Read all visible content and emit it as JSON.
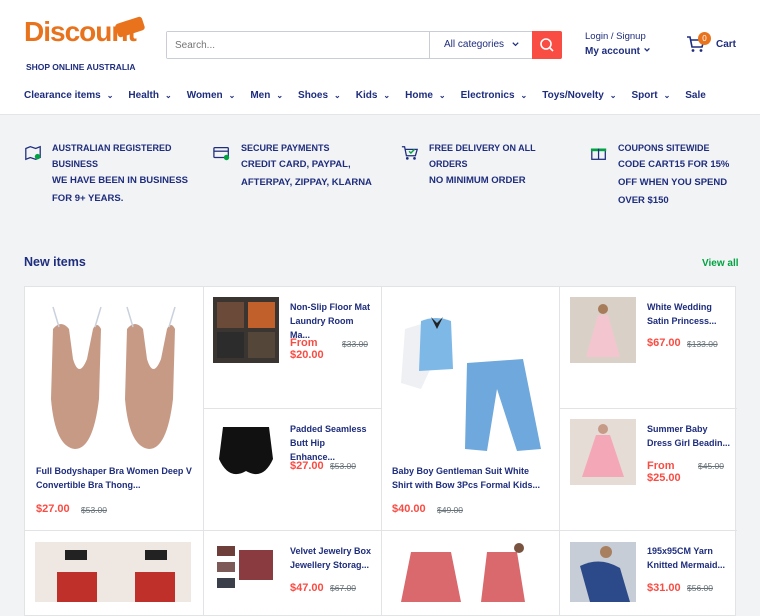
{
  "logo": {
    "word": "Discount",
    "tagline": "SHOP ONLINE AUSTRALIA"
  },
  "search": {
    "placeholder": "Search...",
    "category": "All categories"
  },
  "account": {
    "login": "Login / Signup",
    "my_account": "My account"
  },
  "cart": {
    "count": "0",
    "label": "Cart"
  },
  "nav": [
    "Clearance items",
    "Health",
    "Women",
    "Men",
    "Shoes",
    "Kids",
    "Home",
    "Electronics",
    "Toys/Novelty",
    "Sport",
    "Sale"
  ],
  "features": [
    {
      "title": "AUSTRALIAN REGISTERED BUSINESS",
      "desc": "WE HAVE BEEN IN BUSINESS FOR 9+ YEARS.",
      "icon": "map-pin-icon"
    },
    {
      "title": "Secure payments",
      "desc": "CREDIT CARD, PAYPAL, AFTERPAY, ZIPPAY, KLARNA",
      "icon": "credit-card-icon"
    },
    {
      "title": "FREE DELIVERY ON ALL ORDERS",
      "desc": "NO MINIMUM ORDER",
      "icon": "delivery-cart-icon"
    },
    {
      "title": "COUPONS SITEWIDE",
      "desc": "CODE CART15 FOR 15% OFF WHEN YOU SPEND OVER $150",
      "icon": "gift-icon"
    }
  ],
  "section": {
    "title": "New items",
    "view_all": "View all"
  },
  "products": {
    "big1": {
      "title": "Full Bodyshaper Bra Women Deep V Convertible Bra Thong...",
      "price": "$27.00",
      "old": "$53.00"
    },
    "s1": {
      "title": "Non-Slip Floor Mat Laundry Room Ma...",
      "price": "From $20.00",
      "old": "$33.00"
    },
    "s2": {
      "title": "Padded Seamless Butt Hip Enhance...",
      "price": "$27.00",
      "old": "$53.00"
    },
    "big2": {
      "title": "Baby Boy Gentleman Suit White Shirt with Bow 3Pcs Formal Kids...",
      "price": "$40.00",
      "old": "$49.00"
    },
    "s3": {
      "title": "White Wedding Satin Princess...",
      "price": "$67.00",
      "old": "$133.00"
    },
    "s4": {
      "title": "Summer Baby Dress Girl Beadin...",
      "price": "From $25.00",
      "old": "$45.00"
    },
    "s5": {
      "title": "Velvet Jewelry Box Jewellery Storag...",
      "price": "$47.00",
      "old": "$67.00"
    },
    "s6": {
      "title": "195x95CM Yarn Knitted Mermaid...",
      "price": "$31.00",
      "old": "$56.00"
    }
  },
  "colors": {
    "brand": "#1e2d7d",
    "accent": "#e8731c",
    "sale": "#f94c43",
    "green": "#00a341"
  }
}
